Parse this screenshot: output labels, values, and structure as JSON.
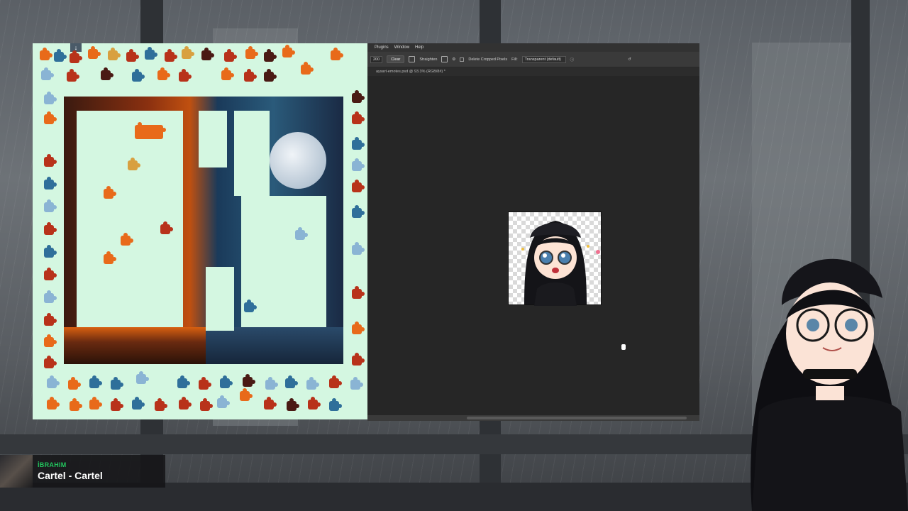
{
  "photoshop": {
    "menu": [
      "Plugins",
      "Window",
      "Help"
    ],
    "options": {
      "size_value": "200",
      "clear_label": "Clear",
      "straighten_label": "Straighten",
      "delete_cropped_label": "Delete Cropped Pixels",
      "fill_label": "Fill:",
      "fill_value": "Transparent (default)"
    },
    "doc_tab": "aysart-emotes.psd @ 93.3% (RGB/8#) *"
  },
  "now_playing": {
    "user": "İBRAHIM",
    "song": "Cartel - Cartel"
  },
  "colors": {
    "puzzle_bg": "#d4f7e1",
    "photoshop_bg": "#262626",
    "now_playing_user": "#22c55e"
  }
}
